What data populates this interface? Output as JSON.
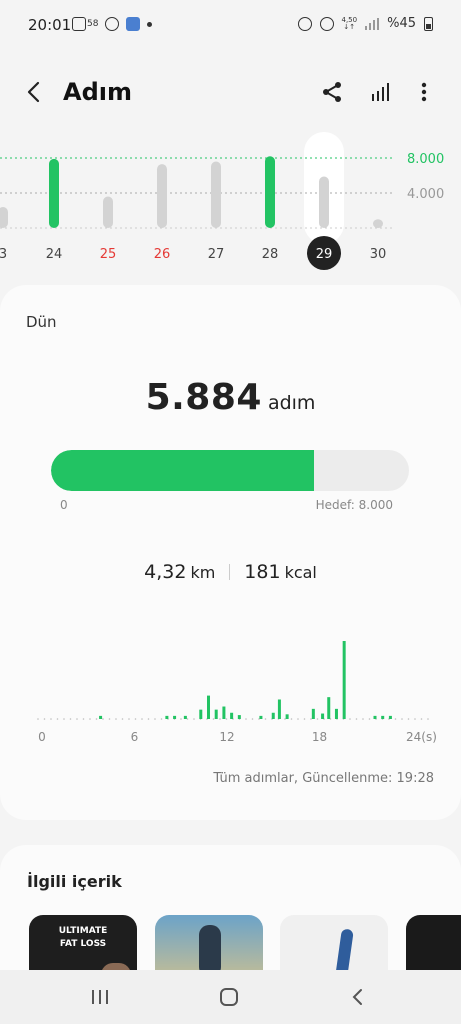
{
  "status_bar": {
    "time": "20:01",
    "icon_badge": "58",
    "net_speed_top": "4,50",
    "net_speed_bottom": "↓↑",
    "battery": "%45"
  },
  "header": {
    "title": "Adım"
  },
  "week_chart": {
    "days": [
      {
        "label": "3",
        "value": 2400,
        "color": "#d3d3d3",
        "label_color": "#444"
      },
      {
        "label": "24",
        "value": 7900,
        "color": "#22c363",
        "label_color": "#444"
      },
      {
        "label": "25",
        "value": 3600,
        "color": "#d3d3d3",
        "label_color": "#e53935"
      },
      {
        "label": "26",
        "value": 7300,
        "color": "#d3d3d3",
        "label_color": "#e53935"
      },
      {
        "label": "27",
        "value": 7600,
        "color": "#d3d3d3",
        "label_color": "#444"
      },
      {
        "label": "28",
        "value": 8200,
        "color": "#22c363",
        "label_color": "#444"
      },
      {
        "label": "29",
        "value": 5884,
        "color": "#d3d3d3",
        "label_color": "#ffffff",
        "selected": true
      },
      {
        "label": "30",
        "value": 1000,
        "color": "#d3d3d3",
        "label_color": "#444"
      }
    ],
    "ref_lines": [
      {
        "label": "8.000",
        "value": 8000,
        "color": "#22c363"
      },
      {
        "label": "4.000",
        "value": 4000,
        "color": "#aaaaaa"
      }
    ]
  },
  "summary": {
    "day_label": "Dün",
    "steps": "5.884",
    "steps_unit": "adım",
    "progress": 0.7355,
    "progress_min": "0",
    "goal_label": "Hedef: 8.000",
    "distance": "4,32",
    "distance_unit": "km",
    "calories": "181",
    "calories_unit": "kcal",
    "updated": "Tüm adımlar, Güncellenme: 19:28"
  },
  "chart_data": {
    "type": "bar",
    "x_tick_labels": [
      "0",
      "6",
      "12",
      "18",
      "24(s)"
    ],
    "x_range": [
      0,
      24
    ],
    "values_relative": [
      {
        "x": 3.8,
        "v": 0.04
      },
      {
        "x": 8.1,
        "v": 0.04
      },
      {
        "x": 8.6,
        "v": 0.04
      },
      {
        "x": 9.3,
        "v": 0.04
      },
      {
        "x": 10.3,
        "v": 0.12
      },
      {
        "x": 10.8,
        "v": 0.3
      },
      {
        "x": 11.3,
        "v": 0.12
      },
      {
        "x": 11.8,
        "v": 0.16
      },
      {
        "x": 12.3,
        "v": 0.08
      },
      {
        "x": 12.8,
        "v": 0.05
      },
      {
        "x": 14.2,
        "v": 0.04
      },
      {
        "x": 15.0,
        "v": 0.08
      },
      {
        "x": 15.4,
        "v": 0.25
      },
      {
        "x": 15.9,
        "v": 0.06
      },
      {
        "x": 17.6,
        "v": 0.13
      },
      {
        "x": 18.2,
        "v": 0.07
      },
      {
        "x": 18.6,
        "v": 0.28
      },
      {
        "x": 19.1,
        "v": 0.13
      },
      {
        "x": 19.6,
        "v": 1.0
      },
      {
        "x": 21.6,
        "v": 0.04
      },
      {
        "x": 22.1,
        "v": 0.04
      },
      {
        "x": 22.6,
        "v": 0.04
      }
    ]
  },
  "related": {
    "title": "İlgili içerik",
    "thumb1_text_line1": "ULTIMATE",
    "thumb1_text_line2": "FAT LOSS"
  },
  "colors": {
    "accent": "#22c363",
    "bar_grey": "#d3d3d3",
    "weekend_red": "#e53935"
  }
}
